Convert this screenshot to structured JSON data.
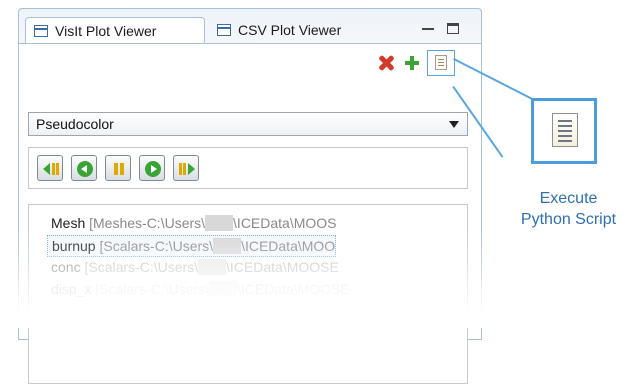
{
  "tabs": [
    {
      "label": "VisIt Plot Viewer",
      "active": true
    },
    {
      "label": "CSV Plot Viewer",
      "active": false
    }
  ],
  "toolbar": {
    "delete_icon": "red-x-icon",
    "add_icon": "green-plus-icon",
    "script_icon": "document-icon"
  },
  "plot_type": {
    "selected": "Pseudocolor"
  },
  "playback": {
    "buttons": [
      "step-back",
      "play-backward",
      "pause",
      "play-forward",
      "step-forward"
    ]
  },
  "plots": [
    {
      "name": "Mesh",
      "detail": " [Meshes-C:\\Users\\",
      "detail2": "\\ICEData\\MOOS"
    },
    {
      "name": "burnup",
      "detail": " [Scalars-C:\\Users\\",
      "detail2": "\\ICEData\\MOO"
    },
    {
      "name": "conc",
      "detail": " [Scalars-C:\\Users\\",
      "detail2": "\\ICEData\\MOOSE"
    },
    {
      "name": "disp_x",
      "detail": " [Scalars-C:\\Users\\",
      "detail2": "\\ICEData\\MOOSE"
    }
  ],
  "callout": {
    "line1": "Execute",
    "line2": "Python Script"
  },
  "colors": {
    "accent": "#4a9ee0",
    "delete": "#d33a2a",
    "add": "#3aa536",
    "play": "#3aa536",
    "pause": "#e0a800"
  }
}
